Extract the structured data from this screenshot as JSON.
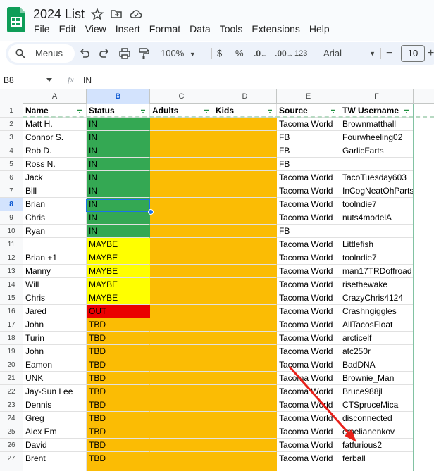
{
  "header": {
    "title": "2024 List",
    "menu": [
      "File",
      "Edit",
      "View",
      "Insert",
      "Format",
      "Data",
      "Tools",
      "Extensions",
      "Help"
    ]
  },
  "toolbar": {
    "menus_label": "Menus",
    "zoom": "100%",
    "currency": "$",
    "percent": "%",
    "decrease_decimal": ".0",
    "increase_decimal": ".00",
    "number_format": "123",
    "font_family": "Arial",
    "font_size": "10"
  },
  "formula_bar": {
    "cell_ref": "B8",
    "fx": "fx",
    "value": "IN"
  },
  "grid": {
    "columns": [
      "A",
      "B",
      "C",
      "D",
      "E",
      "F"
    ],
    "selected_column": "B",
    "selected_row": 8,
    "headers": [
      "Name",
      "Status",
      "Adults",
      "Kids",
      "Source",
      "TW Username"
    ],
    "rows": [
      {
        "num": "2",
        "name": "Matt H.",
        "status": "IN",
        "source": "Tacoma World",
        "tw": "Brownmatthall"
      },
      {
        "num": "3",
        "name": "Connor S.",
        "status": "IN",
        "source": "FB",
        "tw": "Fourwheeling02"
      },
      {
        "num": "4",
        "name": "Rob D.",
        "status": "IN",
        "source": "FB",
        "tw": "GarlicFarts"
      },
      {
        "num": "5",
        "name": "Ross N.",
        "status": "IN",
        "source": "FB",
        "tw": ""
      },
      {
        "num": "6",
        "name": "Jack",
        "status": "IN",
        "source": "Tacoma World",
        "tw": "TacoTuesday603"
      },
      {
        "num": "7",
        "name": "Bill",
        "status": "IN",
        "source": "Tacoma World",
        "tw": "InCogNeatOhParts"
      },
      {
        "num": "8",
        "name": "Brian",
        "status": "IN",
        "source": "Tacoma World",
        "tw": "toolndie7"
      },
      {
        "num": "9",
        "name": "Chris",
        "status": "IN",
        "source": "Tacoma World",
        "tw": "nuts4modelA"
      },
      {
        "num": "10",
        "name": "Ryan",
        "status": "IN",
        "source": "FB",
        "tw": ""
      },
      {
        "num": "11",
        "name": "",
        "status": "MAYBE",
        "source": "Tacoma World",
        "tw": "Littlefish"
      },
      {
        "num": "12",
        "name": "Brian +1",
        "status": "MAYBE",
        "source": "Tacoma World",
        "tw": "toolndie7"
      },
      {
        "num": "13",
        "name": "Manny",
        "status": "MAYBE",
        "source": "Tacoma World",
        "tw": "man17TRDoffroad"
      },
      {
        "num": "14",
        "name": "Will",
        "status": "MAYBE",
        "source": "Tacoma World",
        "tw": "risethewake"
      },
      {
        "num": "15",
        "name": "Chris",
        "status": "MAYBE",
        "source": "Tacoma World",
        "tw": "CrazyChris4124"
      },
      {
        "num": "16",
        "name": "Jared",
        "status": "OUT",
        "source": "Tacoma World",
        "tw": "Crashngiggles"
      },
      {
        "num": "17",
        "name": "John",
        "status": "TBD",
        "source": "Tacoma World",
        "tw": "AllTacosFloat"
      },
      {
        "num": "18",
        "name": "Turin",
        "status": "TBD",
        "source": "Tacoma World",
        "tw": "arcticelf"
      },
      {
        "num": "19",
        "name": "John",
        "status": "TBD",
        "source": "Tacoma World",
        "tw": "atc250r"
      },
      {
        "num": "20",
        "name": "Eamon",
        "status": "TBD",
        "source": "Tacoma World",
        "tw": "BadDNA"
      },
      {
        "num": "21",
        "name": "UNK",
        "status": "TBD",
        "source": "Tacoma World",
        "tw": "Brownie_Man"
      },
      {
        "num": "22",
        "name": "Jay-Sun Lee",
        "status": "TBD",
        "source": "Tacoma World",
        "tw": "Bruce988jl"
      },
      {
        "num": "23",
        "name": "Dennis",
        "status": "TBD",
        "source": "Tacoma World",
        "tw": "CTSpruceMica"
      },
      {
        "num": "24",
        "name": "Greg",
        "status": "TBD",
        "source": "Tacoma World",
        "tw": "disconnected"
      },
      {
        "num": "25",
        "name": "Alex Em",
        "status": "TBD",
        "source": "Tacoma World",
        "tw": "emelianenkov"
      },
      {
        "num": "26",
        "name": "David",
        "status": "TBD",
        "source": "Tacoma World",
        "tw": "fatfurious2"
      },
      {
        "num": "27",
        "name": "Brent",
        "status": "TBD",
        "source": "Tacoma World",
        "tw": "ferball"
      }
    ]
  },
  "colors": {
    "in": "#34a853",
    "maybe": "#ffff00",
    "out": "#ea0000",
    "tbd": "#fbbc04",
    "arrow": "#e8211a",
    "selection": "#1a73e8"
  }
}
